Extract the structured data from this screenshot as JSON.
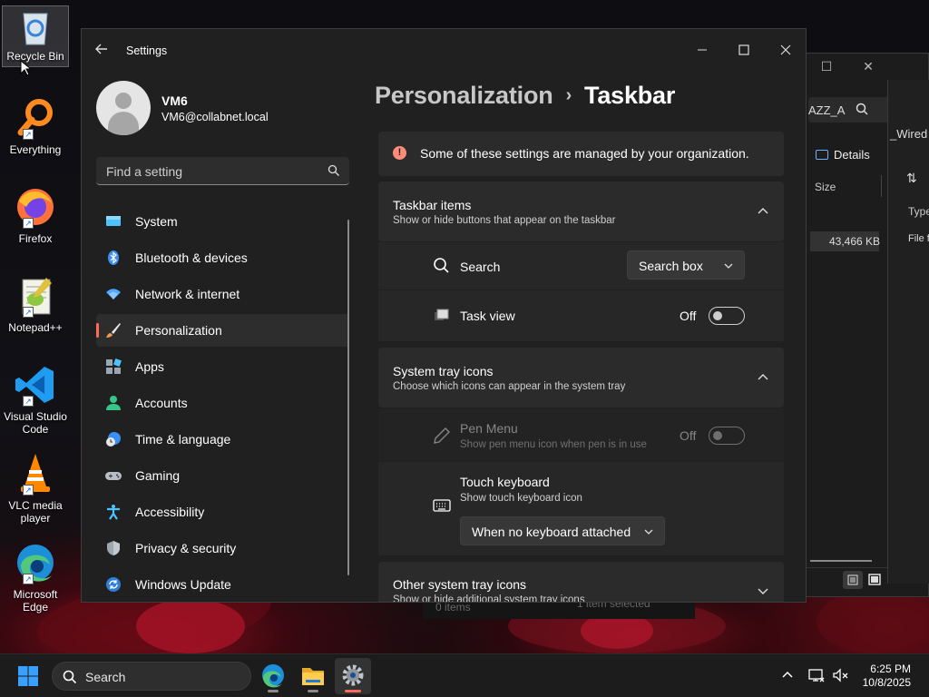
{
  "desktop": {
    "icons": [
      {
        "label": "Recycle Bin"
      },
      {
        "label": "Everything"
      },
      {
        "label": "Firefox"
      },
      {
        "label": "Notepad++"
      },
      {
        "label": "Visual Studio Code"
      },
      {
        "label": "VLC media player"
      },
      {
        "label": "Microsoft Edge"
      }
    ]
  },
  "explorer": {
    "address_fragment": "AZZ_A",
    "tab_fragment": "_Wired",
    "details_label": "Details",
    "column_size": "Size",
    "column_type": "Type",
    "file_size": "43,466 KB",
    "file_type": "File f",
    "status_items": "0 items",
    "status_selected": "1 item selected"
  },
  "settings": {
    "app_title": "Settings",
    "user": {
      "name": "VM6",
      "email": "VM6@collabnet.local"
    },
    "search": {
      "placeholder": "Find a setting"
    },
    "nav": [
      {
        "label": "System",
        "icon": "system-icon"
      },
      {
        "label": "Bluetooth & devices",
        "icon": "bluetooth-icon"
      },
      {
        "label": "Network & internet",
        "icon": "wifi-icon"
      },
      {
        "label": "Personalization",
        "icon": "brush-icon",
        "selected": true
      },
      {
        "label": "Apps",
        "icon": "apps-icon"
      },
      {
        "label": "Accounts",
        "icon": "accounts-icon"
      },
      {
        "label": "Time & language",
        "icon": "time-language-icon"
      },
      {
        "label": "Gaming",
        "icon": "gamepad-icon"
      },
      {
        "label": "Accessibility",
        "icon": "accessibility-icon"
      },
      {
        "label": "Privacy & security",
        "icon": "shield-icon"
      },
      {
        "label": "Windows Update",
        "icon": "update-icon"
      }
    ],
    "breadcrumb": {
      "parent": "Personalization",
      "separator": "›",
      "current": "Taskbar"
    },
    "info_banner": "Some of these settings are managed by your organization.",
    "taskbar_items": {
      "title": "Taskbar items",
      "description": "Show or hide buttons that appear on the taskbar",
      "search": {
        "label": "Search",
        "value": "Search box"
      },
      "task_view": {
        "label": "Task view",
        "state": "Off"
      }
    },
    "system_tray": {
      "title": "System tray icons",
      "description": "Choose which icons can appear in the system tray",
      "pen_menu": {
        "label": "Pen Menu",
        "description": "Show pen menu icon when pen is in use",
        "state": "Off"
      },
      "touch_keyboard": {
        "label": "Touch keyboard",
        "description": "Show touch keyboard icon",
        "value": "When no keyboard attached"
      }
    },
    "other_tray": {
      "title": "Other system tray icons",
      "description": "Show or hide additional system tray icons"
    }
  },
  "taskbar": {
    "search_label": "Search",
    "time": "6:25 PM",
    "date": "10/8/2025"
  },
  "colors": {
    "accent": "#ff6b5b",
    "window_bg": "#202020",
    "card_bg": "#2b2b2b"
  }
}
